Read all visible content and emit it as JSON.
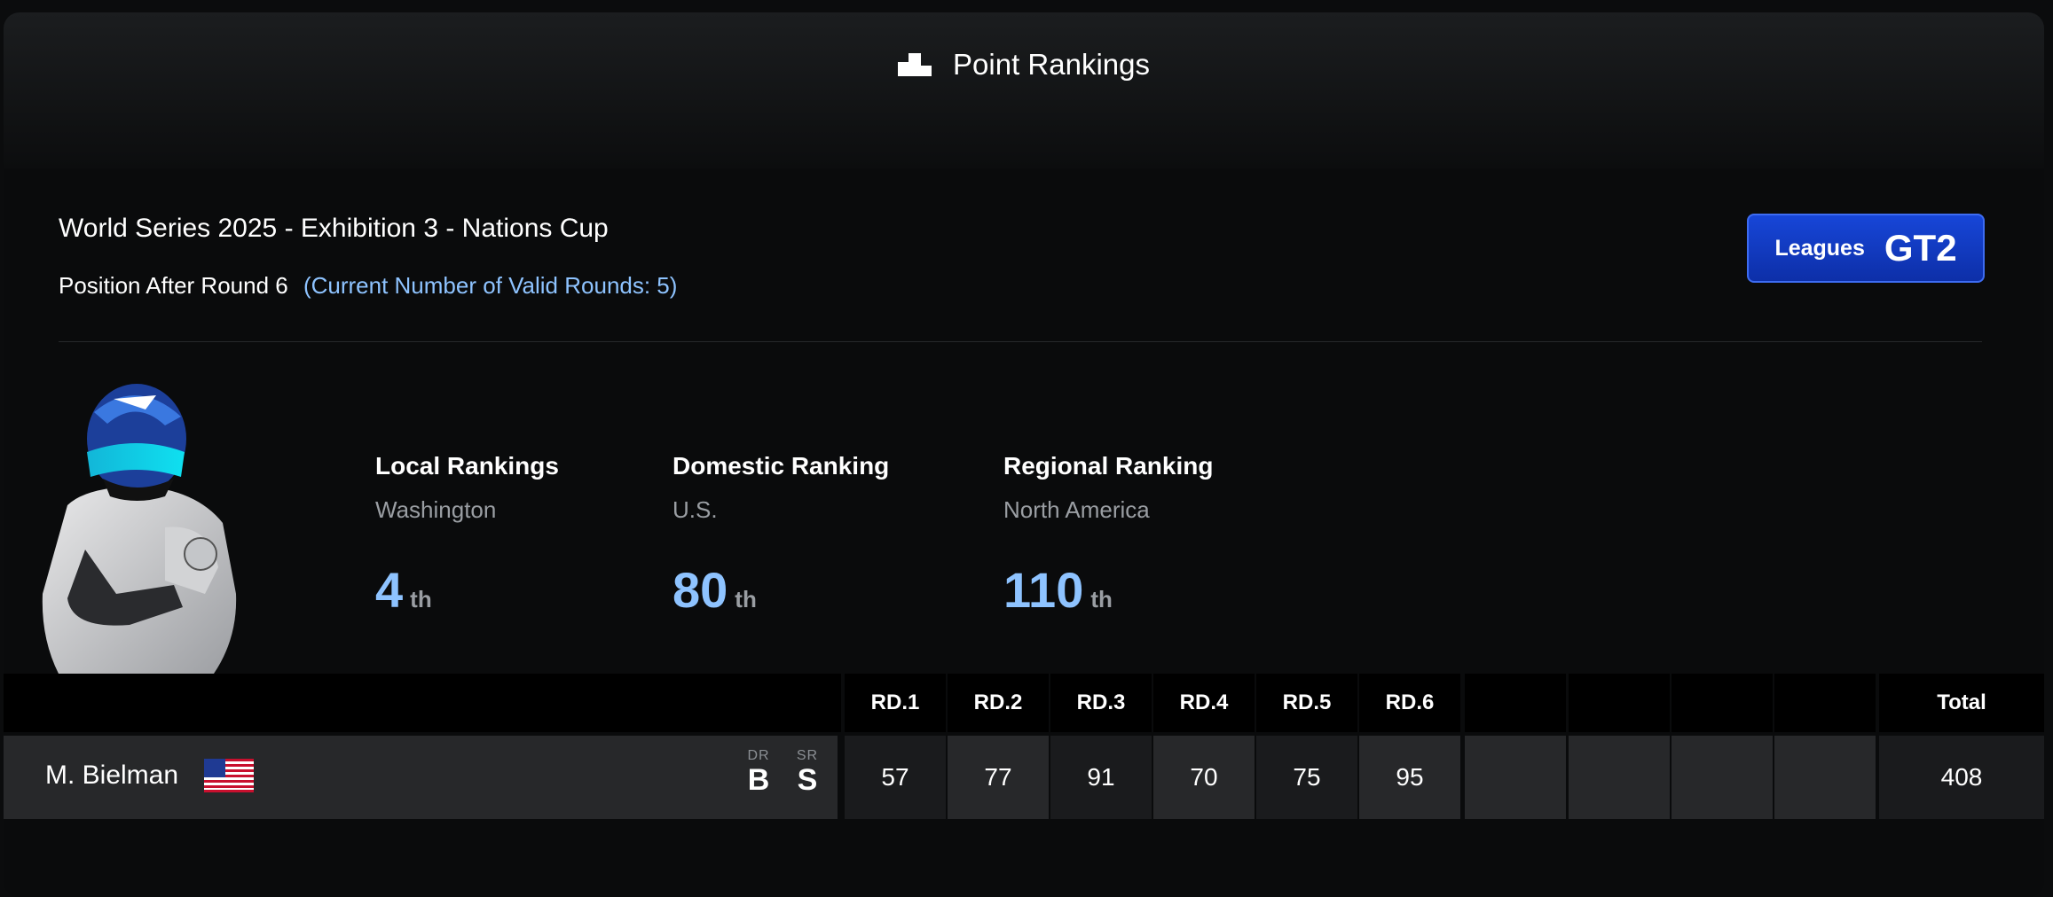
{
  "header": {
    "title": "Point Rankings",
    "icon": "podium-icon"
  },
  "event": {
    "title": "World Series 2025 - Exhibition 3 - Nations Cup",
    "position_after": "Position After Round 6",
    "valid_rounds": "(Current Number of Valid Rounds: 5)"
  },
  "league": {
    "label": "Leagues",
    "value": "GT2"
  },
  "rankings": [
    {
      "title": "Local Rankings",
      "region": "Washington",
      "number": "4",
      "suffix": "th"
    },
    {
      "title": "Domestic Ranking",
      "region": "U.S.",
      "number": "80",
      "suffix": "th"
    },
    {
      "title": "Regional Ranking",
      "region": "North America",
      "number": "110",
      "suffix": "th"
    }
  ],
  "table": {
    "round_headers": [
      "RD.1",
      "RD.2",
      "RD.3",
      "RD.4",
      "RD.5",
      "RD.6",
      "",
      "",
      "",
      ""
    ],
    "total_header": "Total",
    "driver": {
      "name": "M. Bielman",
      "flag": "us-flag-icon",
      "dr_label": "DR",
      "dr_value": "B",
      "sr_label": "SR",
      "sr_value": "S",
      "round_points": [
        "57",
        "77",
        "91",
        "70",
        "75",
        "95",
        "",
        "",
        "",
        ""
      ],
      "total": "408"
    }
  },
  "colors": {
    "accent": "#8ec3ff",
    "league_badge": "#1746d8",
    "background": "#0a0b0c"
  }
}
